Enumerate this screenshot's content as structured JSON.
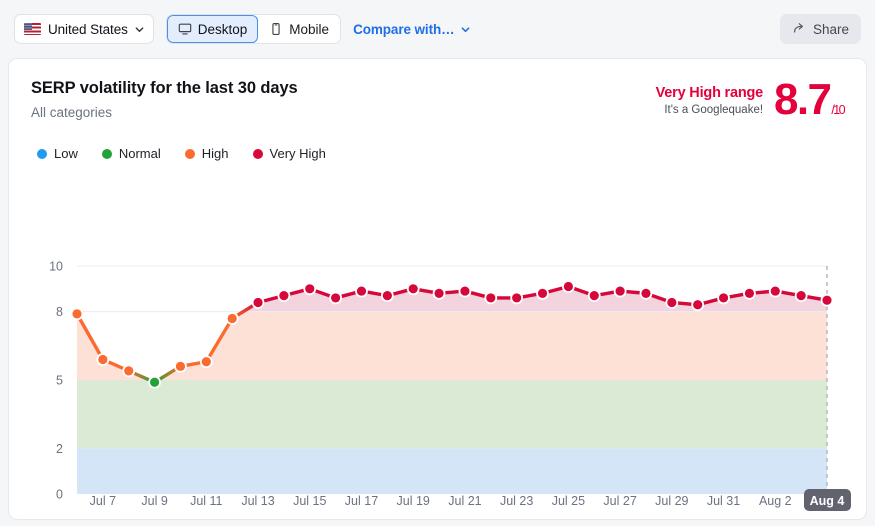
{
  "toolbar": {
    "country": "United States",
    "country_icon": "us-flag-icon",
    "chevron_icon": "chevron-down-icon",
    "devices": [
      {
        "label": "Desktop",
        "icon": "desktop-icon",
        "active": true
      },
      {
        "label": "Mobile",
        "icon": "mobile-icon",
        "active": false
      }
    ],
    "compare_label": "Compare with…",
    "share_label": "Share",
    "share_icon": "share-arrow-icon"
  },
  "card": {
    "title": "SERP volatility for the last 30 days",
    "subtitle": "All categories",
    "range_label": "Very High range",
    "range_note": "It's a Googlequake!",
    "score": "8.7",
    "score_suffix": "/10",
    "accent": "#e4003a"
  },
  "legend": [
    {
      "label": "Low",
      "color": "#1f9cf0"
    },
    {
      "label": "Normal",
      "color": "#22a238"
    },
    {
      "label": "High",
      "color": "#fb6a2e"
    },
    {
      "label": "Very High",
      "color": "#d6083b"
    }
  ],
  "chart_data": {
    "type": "line",
    "title": "SERP volatility for the last 30 days",
    "xlabel": "",
    "ylabel": "",
    "ylim": [
      0,
      10
    ],
    "yticks": [
      0,
      2,
      5,
      8,
      10
    ],
    "grid": false,
    "legend_position": "top-left",
    "x": [
      "Jul 6",
      "Jul 7",
      "Jul 8",
      "Jul 9",
      "Jul 10",
      "Jul 11",
      "Jul 12",
      "Jul 13",
      "Jul 14",
      "Jul 15",
      "Jul 16",
      "Jul 17",
      "Jul 18",
      "Jul 19",
      "Jul 20",
      "Jul 21",
      "Jul 22",
      "Jul 23",
      "Jul 24",
      "Jul 25",
      "Jul 26",
      "Jul 27",
      "Jul 28",
      "Jul 29",
      "Jul 30",
      "Jul 31",
      "Aug 1",
      "Aug 2",
      "Aug 3",
      "Aug 4"
    ],
    "tick_labels": [
      "Jul 7",
      "Jul 9",
      "Jul 11",
      "Jul 13",
      "Jul 15",
      "Jul 17",
      "Jul 19",
      "Jul 21",
      "Jul 23",
      "Jul 25",
      "Jul 27",
      "Jul 29",
      "Jul 31",
      "Aug 2",
      "Aug 4"
    ],
    "highlighted_tick": "Aug 4",
    "values": [
      7.9,
      5.9,
      5.4,
      4.9,
      5.6,
      5.8,
      7.7,
      8.4,
      8.7,
      9.0,
      8.6,
      8.9,
      8.7,
      9.0,
      8.8,
      8.9,
      8.6,
      8.6,
      8.8,
      9.1,
      8.7,
      8.9,
      8.8,
      8.4,
      8.3,
      8.6,
      8.8,
      8.9,
      8.7,
      8.5
    ],
    "point_levels": [
      "high",
      "high",
      "high",
      "normal",
      "high",
      "high",
      "high",
      "veryhigh",
      "veryhigh",
      "veryhigh",
      "veryhigh",
      "veryhigh",
      "veryhigh",
      "veryhigh",
      "veryhigh",
      "veryhigh",
      "veryhigh",
      "veryhigh",
      "veryhigh",
      "veryhigh",
      "veryhigh",
      "veryhigh",
      "veryhigh",
      "veryhigh",
      "veryhigh",
      "veryhigh",
      "veryhigh",
      "veryhigh",
      "veryhigh",
      "veryhigh"
    ],
    "bands": [
      {
        "name": "Low",
        "from": 0,
        "to": 2,
        "color": "#d3e5f7"
      },
      {
        "name": "Normal",
        "from": 2,
        "to": 5,
        "color": "#dbead5"
      },
      {
        "name": "High",
        "from": 5,
        "to": 8,
        "color": "#fde0d6"
      },
      {
        "name": "Very High",
        "from": 8,
        "to": 10,
        "color": "#f3d3dd"
      }
    ]
  }
}
